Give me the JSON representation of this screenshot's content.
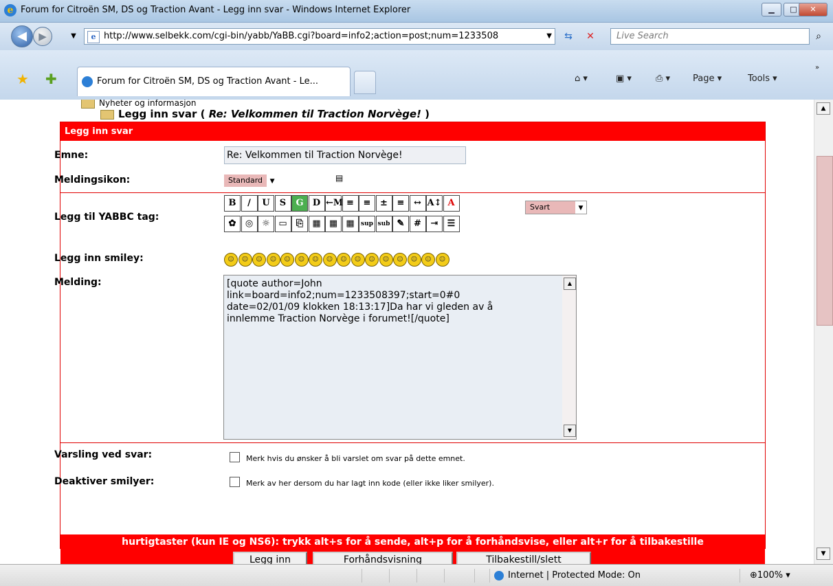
{
  "window": {
    "title": "Forum for Citroën SM, DS og Traction Avant - Legg inn svar - Windows Internet Explorer",
    "minimize": "▁",
    "maximize": "□",
    "close": "✕"
  },
  "address": {
    "url": "http://www.selbekk.com/cgi-bin/yabb/YaBB.cgi?board=info2;action=post;num=1233508",
    "search_placeholder": "Live Search"
  },
  "tab": {
    "label": "Forum for Citroën SM, DS og Traction Avant - Le..."
  },
  "commands": {
    "page": "Page ▾",
    "tools": "Tools ▾"
  },
  "breadcrumb": {
    "level1": "Nyheter og informasjon",
    "level2_prefix": "Legg inn svar ( ",
    "level2_topic": "Re: Velkommen til Traction Norvège!",
    "level2_suffix": " )"
  },
  "form": {
    "header": "Legg inn svar",
    "subject_label": "Emne:",
    "subject_value": "Re: Velkommen til Traction Norvège!",
    "icon_label": "Meldingsikon:",
    "icon_value": "Standard",
    "yabbc_label": "Legg til YABBC tag:",
    "color_value": "Svart",
    "smiley_label": "Legg inn smiley:",
    "message_label": "Melding:",
    "message_text": "[quote author=John\nlink=board=info2;num=1233508397;start=0#0\ndate=02/01/09 klokken 18:13:17]Da har vi gleden av å\ninnlemme Traction Norvège i forumet![/quote]",
    "notify_label": "Varsling ved svar:",
    "notify_text": "Merk hvis du ønsker å bli varslet om svar på dette emnet.",
    "nosmiley_label": "Deaktiver smilyer:",
    "nosmiley_text": "Merk av her dersom du har lagt inn kode (eller ikke liker smilyer).",
    "hotkeys": "hurtigtaster (kun IE og NS6): trykk alt+s for å sende, alt+p for å forhåndsvise, eller alt+r for å tilbakestille",
    "submit": "Legg inn",
    "preview": "Forhåndsvisning",
    "reset": "Tilbakestill/slett"
  },
  "toolbar_row1": [
    "B",
    "/",
    "U",
    "S",
    "G",
    "D",
    "←M",
    "≡",
    "≡",
    "±",
    "≡",
    "↔",
    "A↕",
    "A"
  ],
  "toolbar_row2": [
    "✿",
    "◎",
    "☼",
    "▭",
    "⎘",
    "▦",
    "▦",
    "▦",
    "sup",
    "sub",
    "✎",
    "#",
    "⇥",
    "☰"
  ],
  "smilies": [
    "☺",
    "☺",
    "☺",
    "☺",
    "☺",
    "☺",
    "☺",
    "☺",
    "☺",
    "☺",
    "☺",
    "☺",
    "☺",
    "☺",
    "☺",
    "☺"
  ],
  "status": {
    "zone": "Internet | Protected Mode: On",
    "zoom": "100%"
  }
}
